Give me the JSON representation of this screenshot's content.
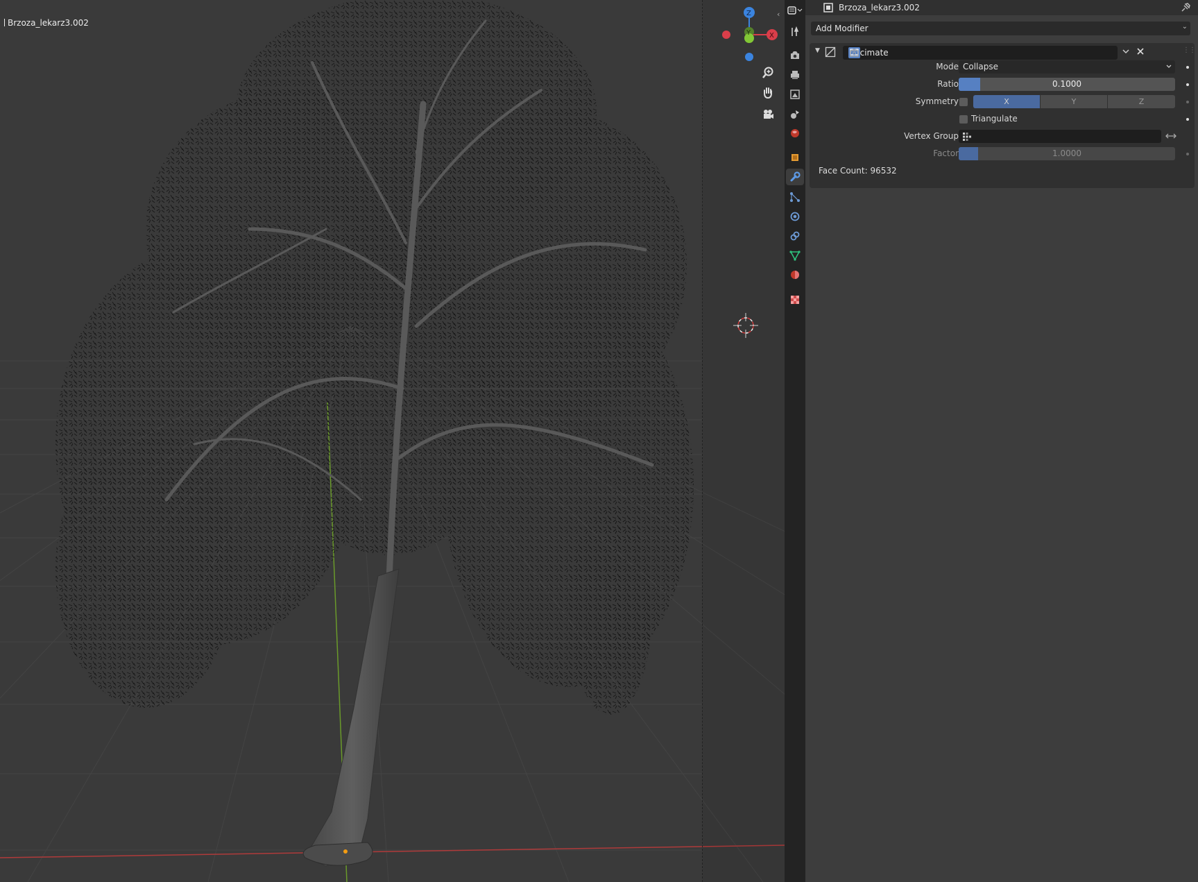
{
  "viewport": {
    "object_label": "Brzoza_lekarz3.002",
    "gizmo": {
      "z_label": "Z",
      "y_label": "Y",
      "x_label": "X"
    }
  },
  "properties": {
    "object_name": "Brzoza_lekarz3.002",
    "add_modifier_label": "Add Modifier",
    "modifier": {
      "name": "Decimate",
      "mode_label": "Mode",
      "mode_value": "Collapse",
      "ratio_label": "Ratio",
      "ratio_value": "0.1000",
      "ratio_fraction": 0.1,
      "symmetry_label": "Symmetry",
      "symmetry_enabled": false,
      "symmetry_axes": [
        "X",
        "Y",
        "Z"
      ],
      "triangulate_label": "Triangulate",
      "triangulate_enabled": false,
      "vertex_group_label": "Vertex Group",
      "vertex_group_value": "",
      "factor_label": "Factor",
      "factor_value": "1.0000",
      "face_count": "Face Count: 96532"
    }
  },
  "colors": {
    "accent": "#5680c2",
    "viewport_bg": "#3a3a3a",
    "panel_bg": "#3d3d3d",
    "axis_x": "#e8424f",
    "axis_y": "#8bd53a",
    "axis_z": "#3f8ded"
  },
  "tabs": [
    "tool-icon",
    "render-icon",
    "output-icon",
    "view-layer-icon",
    "scene-icon",
    "world-icon",
    "object-icon",
    "modifier-wrench-icon",
    "particles-icon",
    "physics-icon",
    "constraints-icon",
    "data-icon",
    "material-icon",
    "texture-icon"
  ]
}
